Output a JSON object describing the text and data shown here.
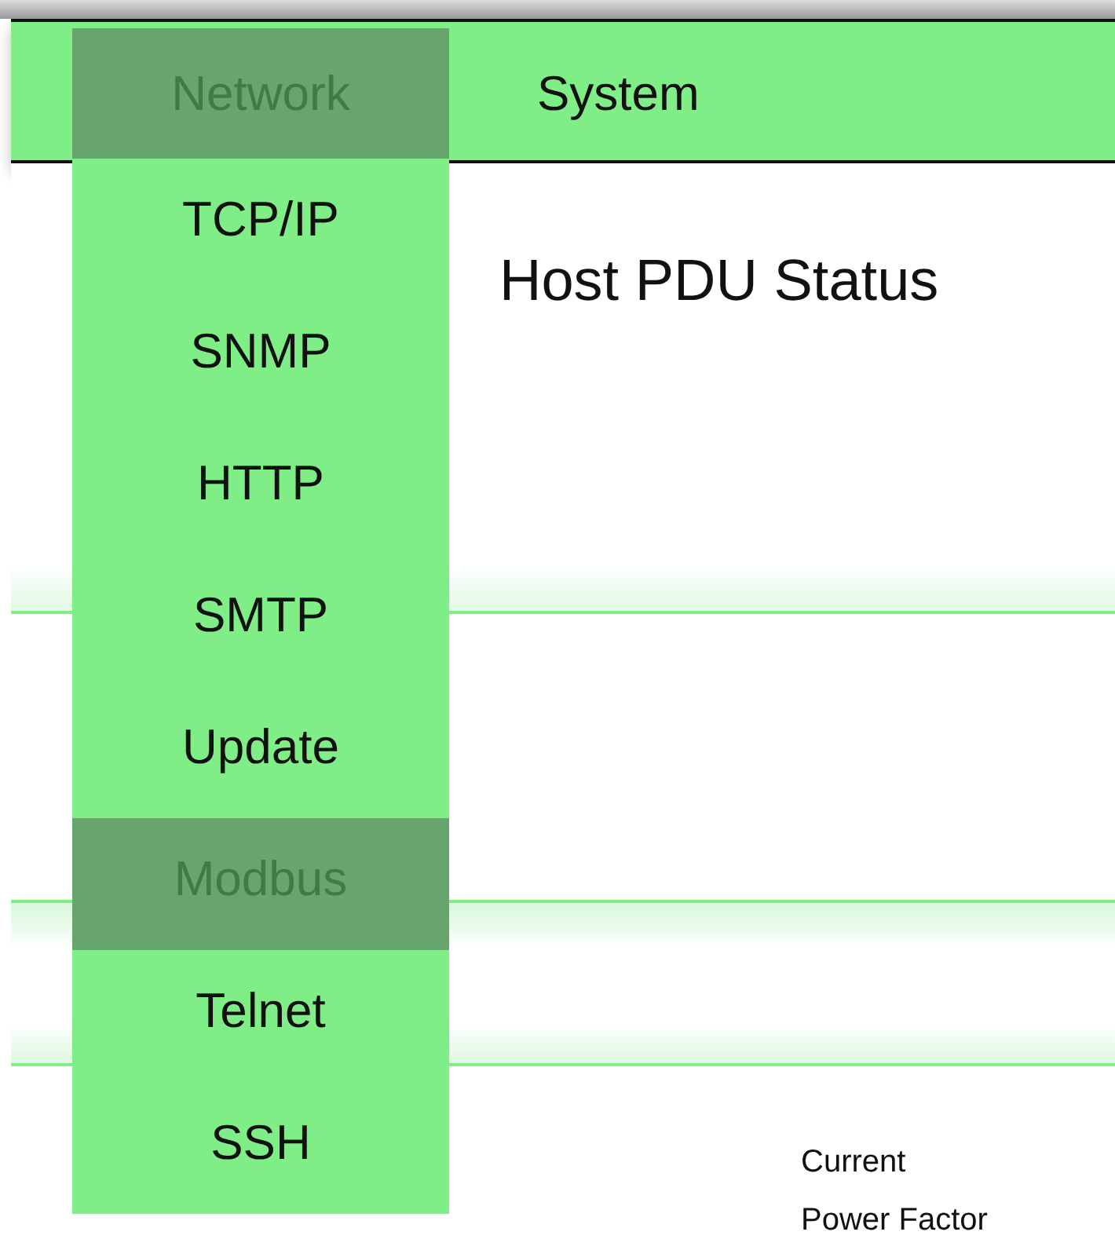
{
  "nav": {
    "tabs": [
      {
        "label": "Network",
        "selected": true
      },
      {
        "label": "System",
        "selected": false
      }
    ]
  },
  "menu": {
    "items": [
      {
        "label": "TCP/IP",
        "selected": false
      },
      {
        "label": "SNMP",
        "selected": false
      },
      {
        "label": "HTTP",
        "selected": false
      },
      {
        "label": "SMTP",
        "selected": false
      },
      {
        "label": "Update",
        "selected": false
      },
      {
        "label": "Modbus",
        "selected": true
      },
      {
        "label": "Telnet",
        "selected": false
      },
      {
        "label": "SSH",
        "selected": false
      }
    ]
  },
  "content": {
    "title": "Host PDU Status",
    "labels": [
      "Current",
      "Power Factor"
    ]
  }
}
